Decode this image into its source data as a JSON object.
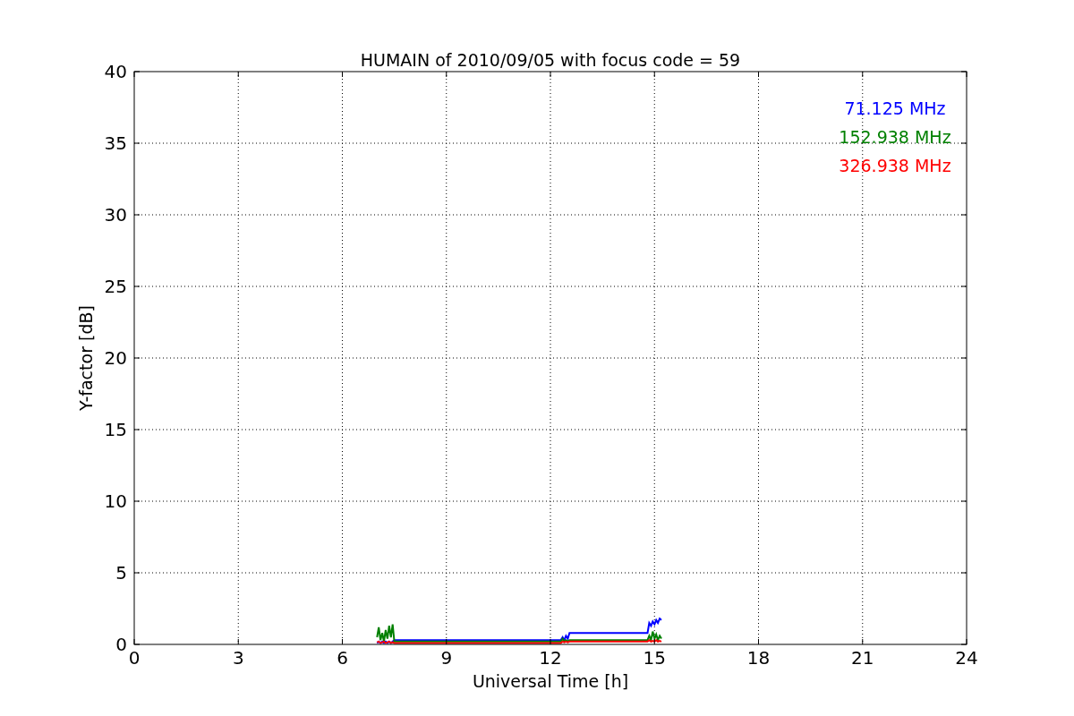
{
  "chart_data": {
    "type": "line",
    "title": "HUMAIN of 2010/09/05 with focus code = 59",
    "xlabel": "Universal Time [h]",
    "ylabel": "Y-factor [dB]",
    "x": [
      7.0,
      7.05,
      7.1,
      7.15,
      7.2,
      7.25,
      7.3,
      7.35,
      7.4,
      7.45,
      7.5,
      12.3,
      12.35,
      12.4,
      12.45,
      12.5,
      12.55,
      14.8,
      14.85,
      14.9,
      14.95,
      15.0,
      15.05,
      15.1,
      15.15,
      15.2
    ],
    "series": [
      {
        "name": "71.125 MHz",
        "color": "#0000ff",
        "values": [
          0.1,
          0.2,
          0.1,
          0.2,
          0.1,
          0.2,
          0.1,
          0.2,
          0.1,
          0.2,
          0.3,
          0.3,
          0.5,
          0.3,
          0.6,
          0.4,
          0.8,
          0.8,
          1.5,
          1.3,
          1.6,
          1.4,
          1.7,
          1.5,
          1.8,
          1.7
        ]
      },
      {
        "name": "152.938 MHz",
        "color": "#008000",
        "values": [
          0.5,
          1.2,
          0.3,
          0.8,
          0.2,
          1.0,
          0.4,
          1.3,
          0.5,
          1.4,
          0.2,
          0.2,
          0.4,
          0.2,
          0.3,
          0.2,
          0.3,
          0.3,
          0.6,
          0.3,
          0.9,
          0.4,
          0.7,
          0.3,
          0.6,
          0.4
        ]
      },
      {
        "name": "326.938 MHz",
        "color": "#ff0000",
        "values": [
          0.15,
          0.2,
          0.1,
          0.15,
          0.2,
          0.1,
          0.15,
          0.2,
          0.1,
          0.15,
          0.1,
          0.1,
          0.2,
          0.15,
          0.2,
          0.15,
          0.2,
          0.2,
          0.3,
          0.2,
          0.25,
          0.2,
          0.3,
          0.2,
          0.25,
          0.2
        ]
      }
    ],
    "xlim": [
      0,
      24
    ],
    "ylim": [
      0,
      40
    ],
    "xticks": [
      0,
      3,
      6,
      9,
      12,
      15,
      18,
      21,
      24
    ],
    "yticks": [
      0,
      5,
      10,
      15,
      20,
      25,
      30,
      35,
      40
    ],
    "grid": true
  }
}
